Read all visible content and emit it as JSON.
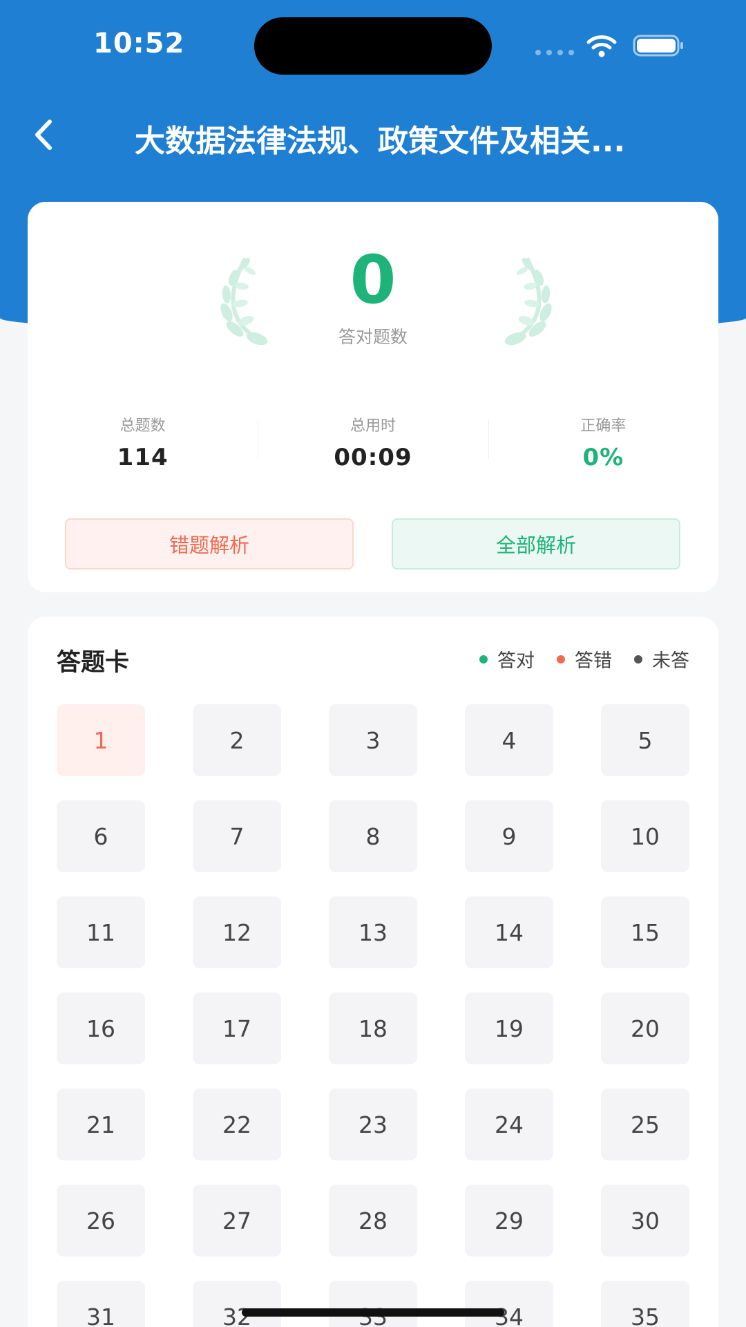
{
  "status": {
    "time": "10:52"
  },
  "nav": {
    "title": "大数据法律法规、政策文件及相关..."
  },
  "summary": {
    "correct_count": "0",
    "correct_label": "答对题数",
    "stats": [
      {
        "label": "总题数",
        "value": "114"
      },
      {
        "label": "总用时",
        "value": "00:09"
      },
      {
        "label": "正确率",
        "value": "0%"
      }
    ],
    "wrong_analysis_button": "错题解析",
    "all_analysis_button": "全部解析"
  },
  "answer_card": {
    "title": "答题卡",
    "legend": [
      {
        "label": "答对",
        "color": "#1db37a"
      },
      {
        "label": "答错",
        "color": "#f26a4f"
      },
      {
        "label": "未答",
        "color": "#555555"
      }
    ],
    "active_question": "1",
    "questions": [
      "1",
      "2",
      "3",
      "4",
      "5",
      "6",
      "7",
      "8",
      "9",
      "10",
      "11",
      "12",
      "13",
      "14",
      "15",
      "16",
      "17",
      "18",
      "19",
      "20",
      "21",
      "22",
      "23",
      "24",
      "25",
      "26",
      "27",
      "28",
      "29",
      "30",
      "31",
      "32",
      "33",
      "34",
      "35"
    ]
  },
  "colors": {
    "brand": "#1e7fd3",
    "correct": "#1db37a",
    "wrong": "#f26a4f"
  }
}
